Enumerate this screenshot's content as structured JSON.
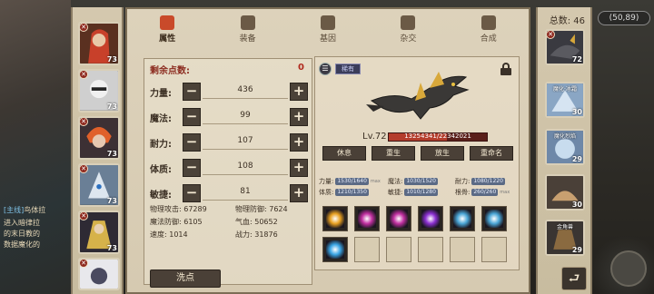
{
  "map": {
    "coord": "(50,89)",
    "quest_line1": "[主线]",
    "quest_line1b": "鸟体拉",
    "quest_line2": "进入暗律拉",
    "quest_line3": "的末日教的",
    "quest_line4": "数据魔化的"
  },
  "left_heroes": [
    {
      "level": "73",
      "badge": "✕"
    },
    {
      "level": "73",
      "badge": "✕"
    },
    {
      "level": "73",
      "badge": "✕"
    },
    {
      "level": "73",
      "badge": "✕"
    },
    {
      "level": "73",
      "badge": "✕"
    },
    {
      "level": "73",
      "badge": "✕"
    }
  ],
  "tabs": [
    {
      "label": "属性",
      "active": true
    },
    {
      "label": "装备",
      "active": false
    },
    {
      "label": "基因",
      "active": false
    },
    {
      "label": "杂交",
      "active": false
    },
    {
      "label": "合成",
      "active": false
    }
  ],
  "stats_panel": {
    "remaining_label": "剩余点数:",
    "remaining_value": "0",
    "rows": [
      {
        "name": "力量:",
        "value": "436"
      },
      {
        "name": "魔法:",
        "value": "99"
      },
      {
        "name": "耐力:",
        "value": "107"
      },
      {
        "name": "体质:",
        "value": "108"
      },
      {
        "name": "敏捷:",
        "value": "81"
      }
    ],
    "minus_symbol": "−",
    "plus_symbol": "+",
    "derived": {
      "phys_atk": "物理攻击: 67289",
      "phys_def": "物理防御: 7624",
      "mag_def": "魔法防御: 6105",
      "qi_xue": "气血: 50652",
      "speed": "速度: 1014",
      "power": "战力: 31876"
    },
    "wash_label": "洗点"
  },
  "detail": {
    "skin_icon": "☰",
    "rarity": "稀有",
    "level": "Lv.72",
    "exp_text": "13254341/22342021",
    "exp_fraction": 0.593,
    "actions": [
      "休息",
      "重生",
      "放生",
      "重命名"
    ],
    "sub_stats": [
      {
        "label": "力量:",
        "pill": "1530/1640",
        "max": "max"
      },
      {
        "label": "魔法:",
        "pill": "1030/1520",
        "max": ""
      },
      {
        "label": "耐力:",
        "pill": "1080/1220",
        "max": ""
      },
      {
        "label": "体质:",
        "pill": "1210/1350",
        "max": ""
      },
      {
        "label": "敏捷:",
        "pill": "1010/1280",
        "max": ""
      },
      {
        "label": "根骨:",
        "pill": "260/260",
        "max": "max"
      }
    ],
    "skill_colors": [
      "#e8a020",
      "#c02fa0",
      "#c02fa0",
      "#8a2fd0",
      "#4aa6d6",
      "#4aa6d6",
      "#3aa6e6"
    ],
    "empty_slots": 5
  },
  "right_col": {
    "total": "总数: 46",
    "heroes": [
      {
        "name": "",
        "level": "72",
        "badge": "✕"
      },
      {
        "name": "魔化·冰霜",
        "level": "30",
        "badge": ""
      },
      {
        "name": "魔化烈焰",
        "level": "29",
        "badge": ""
      },
      {
        "name": "",
        "level": "30",
        "badge": ""
      },
      {
        "name": "金角兽",
        "level": "29",
        "badge": ""
      }
    ]
  },
  "colors": {
    "accent_red": "#b02a1e",
    "button_dark": "#4a4037",
    "panel_parchment": "#ddd2bb"
  }
}
